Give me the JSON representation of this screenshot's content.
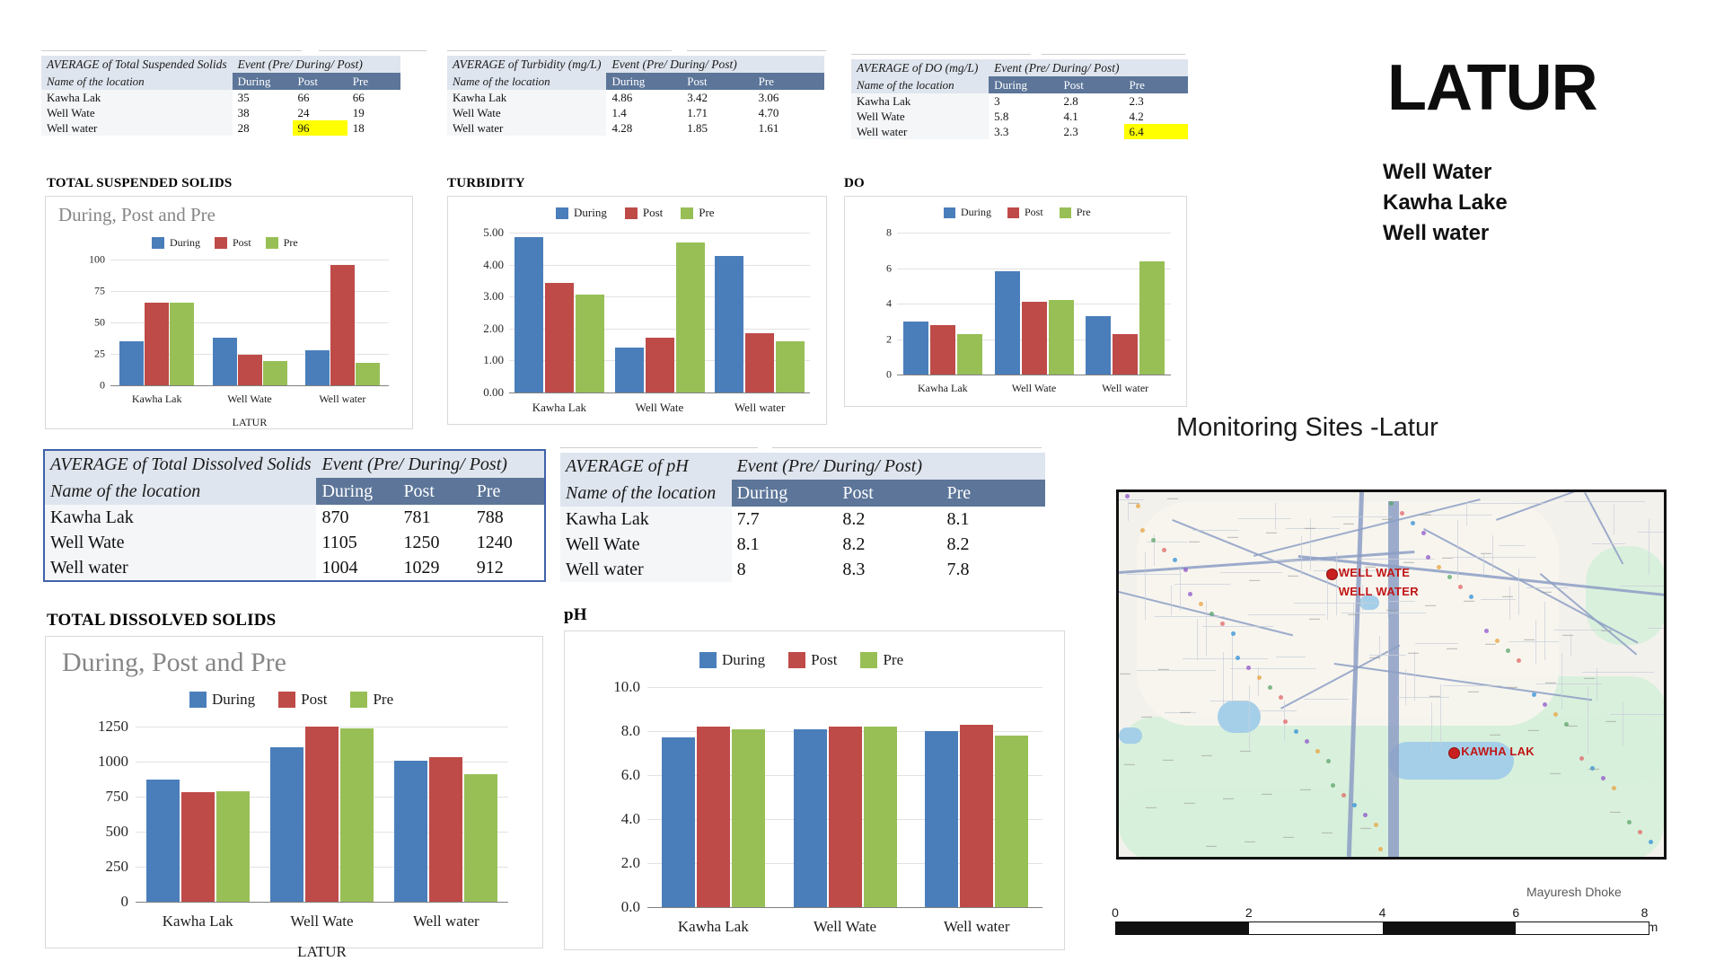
{
  "poster": {
    "headline": "LATUR",
    "site_lines": [
      "Well Water",
      "Kawha Lake",
      "Well water"
    ],
    "map_title": "Monitoring Sites -Latur",
    "credit": "Mayuresh Dhoke"
  },
  "tables": [
    {
      "id": "tss",
      "title": "AVERAGE of Total Suspended Solids",
      "event_header": "Event (Pre/ During/ Post)",
      "loc_header": "Name of the location",
      "columns": [
        "During",
        "Post",
        "Pre"
      ],
      "rows": [
        {
          "location": "Kawha Lak",
          "values": [
            "35",
            "66",
            "66"
          ],
          "highlight": [
            false,
            false,
            false
          ]
        },
        {
          "location": "Well Wate",
          "values": [
            "38",
            "24",
            "19"
          ],
          "highlight": [
            false,
            false,
            false
          ]
        },
        {
          "location": "Well water",
          "values": [
            "28",
            "96",
            "18"
          ],
          "highlight": [
            false,
            true,
            false
          ]
        }
      ]
    },
    {
      "id": "turb",
      "title": "AVERAGE of Turbidity (mg/L)",
      "event_header": "Event (Pre/ During/ Post)",
      "loc_header": "Name of the location",
      "columns": [
        "During",
        "Post",
        "Pre"
      ],
      "rows": [
        {
          "location": "Kawha Lak",
          "values": [
            "4.86",
            "3.42",
            "3.06"
          ],
          "highlight": [
            false,
            false,
            false
          ]
        },
        {
          "location": "Well Wate",
          "values": [
            "1.4",
            "1.71",
            "4.70"
          ],
          "highlight": [
            false,
            false,
            false
          ]
        },
        {
          "location": "Well water",
          "values": [
            "4.28",
            "1.85",
            "1.61"
          ],
          "highlight": [
            false,
            false,
            false
          ]
        }
      ]
    },
    {
      "id": "do",
      "title": "AVERAGE of DO (mg/L)",
      "event_header": "Event (Pre/ During/ Post)",
      "loc_header": "Name of the location",
      "columns": [
        "During",
        "Post",
        "Pre"
      ],
      "rows": [
        {
          "location": "Kawha Lak",
          "values": [
            "3",
            "2.8",
            "2.3"
          ],
          "highlight": [
            false,
            false,
            false
          ]
        },
        {
          "location": "Well Wate",
          "values": [
            "5.8",
            "4.1",
            "4.2"
          ],
          "highlight": [
            false,
            false,
            false
          ]
        },
        {
          "location": "Well water",
          "values": [
            "3.3",
            "2.3",
            "6.4"
          ],
          "highlight": [
            false,
            false,
            true
          ]
        }
      ]
    },
    {
      "id": "tds",
      "title": "AVERAGE of Total Dissolved Solids",
      "event_header": "Event (Pre/ During/ Post)",
      "loc_header": "Name of the location",
      "columns": [
        "During",
        "Post",
        "Pre"
      ],
      "rows": [
        {
          "location": "Kawha Lak",
          "values": [
            "870",
            "781",
            "788"
          ],
          "highlight": [
            false,
            false,
            false
          ]
        },
        {
          "location": "Well Wate",
          "values": [
            "1105",
            "1250",
            "1240"
          ],
          "highlight": [
            false,
            false,
            false
          ]
        },
        {
          "location": "Well water",
          "values": [
            "1004",
            "1029",
            "912"
          ],
          "highlight": [
            false,
            false,
            false
          ]
        }
      ]
    },
    {
      "id": "ph",
      "title": "AVERAGE of pH",
      "event_header": "Event (Pre/ During/ Post)",
      "loc_header": "Name of the location",
      "columns": [
        "During",
        "Post",
        "Pre"
      ],
      "rows": [
        {
          "location": "Kawha Lak",
          "values": [
            "7.7",
            "8.2",
            "8.1"
          ],
          "highlight": [
            false,
            false,
            false
          ]
        },
        {
          "location": "Well Wate",
          "values": [
            "8.1",
            "8.2",
            "8.2"
          ],
          "highlight": [
            false,
            false,
            false
          ]
        },
        {
          "location": "Well water",
          "values": [
            "8",
            "8.3",
            "7.8"
          ],
          "highlight": [
            false,
            false,
            false
          ]
        }
      ]
    }
  ],
  "series_colors": {
    "During": "#4a7ebb",
    "Post": "#be4b48",
    "Pre": "#98bf56"
  },
  "chart_data": [
    {
      "id": "chart-tss",
      "type": "bar",
      "heading": "TOTAL SUSPENDED SOLIDS",
      "title": "During, Post and Pre",
      "categories": [
        "Kawha Lak",
        "Well Wate",
        "Well water"
      ],
      "series": [
        {
          "name": "During",
          "values": [
            35,
            38,
            28
          ]
        },
        {
          "name": "Post",
          "values": [
            66,
            24,
            96
          ]
        },
        {
          "name": "Pre",
          "values": [
            66,
            19,
            18
          ]
        }
      ],
      "yticks": [
        "0",
        "25",
        "50",
        "75",
        "100"
      ],
      "ylim": [
        0,
        100
      ],
      "xlabel": "LATUR",
      "ylabel": "",
      "grid": true,
      "legend": "top"
    },
    {
      "id": "chart-turb",
      "type": "bar",
      "heading": "TURBIDITY",
      "title": "",
      "categories": [
        "Kawha Lak",
        "Well Wate",
        "Well water"
      ],
      "series": [
        {
          "name": "During",
          "values": [
            4.86,
            1.4,
            4.28
          ]
        },
        {
          "name": "Post",
          "values": [
            3.42,
            1.71,
            1.85
          ]
        },
        {
          "name": "Pre",
          "values": [
            3.06,
            4.7,
            1.61
          ]
        }
      ],
      "yticks": [
        "0.00",
        "1.00",
        "2.00",
        "3.00",
        "4.00",
        "5.00"
      ],
      "ylim": [
        0,
        5
      ],
      "xlabel": "",
      "ylabel": "",
      "grid": true,
      "legend": "top"
    },
    {
      "id": "chart-do",
      "type": "bar",
      "heading": "DO",
      "title": "",
      "categories": [
        "Kawha Lak",
        "Well Wate",
        "Well water"
      ],
      "series": [
        {
          "name": "During",
          "values": [
            3,
            5.8,
            3.3
          ]
        },
        {
          "name": "Post",
          "values": [
            2.8,
            4.1,
            2.3
          ]
        },
        {
          "name": "Pre",
          "values": [
            2.3,
            4.2,
            6.4
          ]
        }
      ],
      "yticks": [
        "0",
        "2",
        "4",
        "6",
        "8"
      ],
      "ylim": [
        0,
        8
      ],
      "xlabel": "",
      "ylabel": "",
      "grid": true,
      "legend": "top"
    },
    {
      "id": "chart-tds",
      "type": "bar",
      "heading": "TOTAL DISSOLVED SOLIDS",
      "title": "During, Post and Pre",
      "categories": [
        "Kawha Lak",
        "Well Wate",
        "Well water"
      ],
      "series": [
        {
          "name": "During",
          "values": [
            870,
            1105,
            1004
          ]
        },
        {
          "name": "Post",
          "values": [
            781,
            1250,
            1029
          ]
        },
        {
          "name": "Pre",
          "values": [
            788,
            1240,
            912
          ]
        }
      ],
      "yticks": [
        "0",
        "250",
        "500",
        "750",
        "1000",
        "1250"
      ],
      "ylim": [
        0,
        1250
      ],
      "xlabel": "LATUR",
      "ylabel": "",
      "grid": true,
      "legend": "top"
    },
    {
      "id": "chart-ph",
      "type": "bar",
      "heading": "pH",
      "title": "",
      "categories": [
        "Kawha Lak",
        "Well Wate",
        "Well water"
      ],
      "series": [
        {
          "name": "During",
          "values": [
            7.7,
            8.1,
            8.0
          ]
        },
        {
          "name": "Post",
          "values": [
            8.2,
            8.2,
            8.3
          ]
        },
        {
          "name": "Pre",
          "values": [
            8.1,
            8.2,
            7.8
          ]
        }
      ],
      "yticks": [
        "0.0",
        "2.0",
        "4.0",
        "6.0",
        "8.0",
        "10.0"
      ],
      "ylim": [
        0,
        10
      ],
      "xlabel": "",
      "ylabel": "",
      "grid": true,
      "legend": "top"
    }
  ],
  "map": {
    "markers": [
      {
        "label": "WELL WATE",
        "x": 0.39,
        "y": 0.225
      },
      {
        "label": "WELL WATER",
        "x": 0.39,
        "y": 0.275
      },
      {
        "label": "KAWHA LAK",
        "x": 0.615,
        "y": 0.715
      }
    ],
    "scale": {
      "labels": [
        "0",
        "2",
        "4",
        "6",
        "8 km"
      ],
      "unit": "km",
      "max": 8
    }
  }
}
